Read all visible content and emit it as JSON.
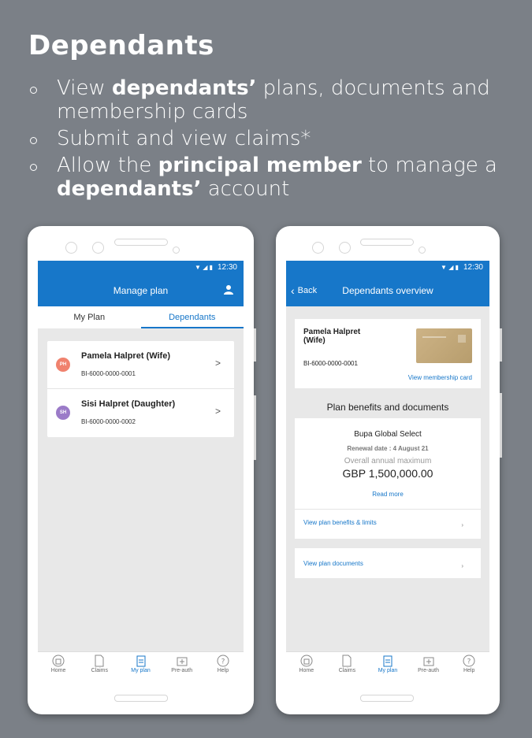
{
  "slide": {
    "title": "Dependants",
    "bullets": [
      {
        "pre": "View ",
        "bold": "dependants’",
        "post": " plans, documents and membership cards"
      },
      {
        "pre": "Submit and view claims*",
        "bold": "",
        "post": ""
      },
      {
        "pre": "Allow the ",
        "bold": "principal member",
        "post": " to manage a ",
        "bold2": "dependants’",
        "post2": " account"
      }
    ]
  },
  "status_time": "12:30",
  "left_screen": {
    "app_title": "Manage plan",
    "tabs": [
      "My Plan",
      "Dependants"
    ],
    "dependants": [
      {
        "initials": "PH",
        "name": "Pamela Halpret (Wife)",
        "id": "BI-6000-0000-0001",
        "color": "#f0826e"
      },
      {
        "initials": "SH",
        "name": "Sisi Halpret (Daughter)",
        "id": "BI-6000-0000-0002",
        "color": "#9b7bc8"
      }
    ]
  },
  "right_screen": {
    "back_label": "Back",
    "app_title": "Dependants overview",
    "member": {
      "name": "Pamela Halpret (Wife)",
      "id": "BI-6000-0000-0001",
      "card_link": "View membership card"
    },
    "section_title": "Plan benefits and documents",
    "plan": {
      "name": "Bupa Global Select",
      "renewal": "Renewal date : 4 August 21",
      "oam_label": "Overall annual maximum",
      "amount": "GBP 1,500,000.00",
      "read_more": "Read more",
      "benefits_link": "View plan benefits & limits",
      "documents_link": "View plan documents"
    }
  },
  "navbar": [
    "Home",
    "Claims",
    "My plan",
    "Pre-auth",
    "Help"
  ],
  "colors": {
    "brand": "#1777c9",
    "background": "#7b8087"
  }
}
